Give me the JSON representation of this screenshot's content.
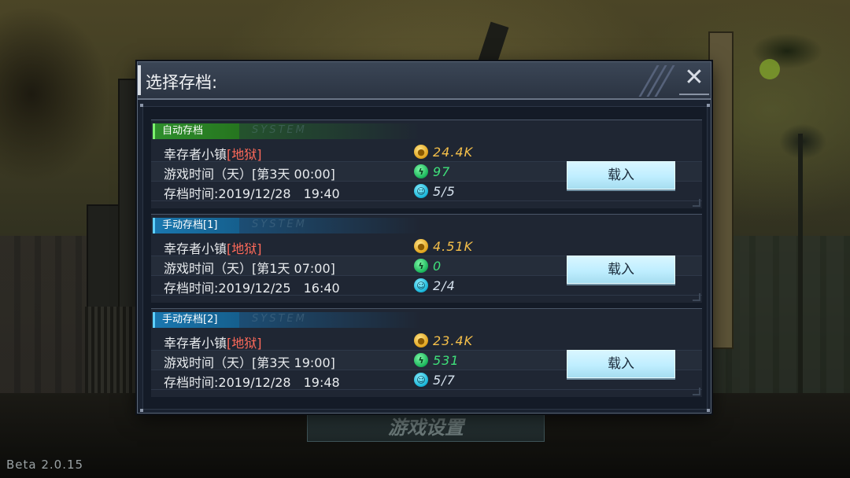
{
  "dialog": {
    "title": "选择存档:",
    "close_label": "✕"
  },
  "slots": [
    {
      "tag": "自动存档",
      "tag_color": "#3cc23a",
      "watermark": "SYSTEM",
      "town_name": "幸存者小镇",
      "difficulty": "[地狱]",
      "playtime": "游戏时间（天）[第3天 00:00]",
      "saved_at": "存档时间:2019/12/28　19:40",
      "coins": "24.4K",
      "energy": "97",
      "survivors": "5/5",
      "load_label": "载入"
    },
    {
      "tag": "手动存档[1]",
      "tag_color": "#1e9ad6",
      "watermark": "SYSTEM",
      "town_name": "幸存者小镇",
      "difficulty": "[地狱]",
      "playtime": "游戏时间（天）[第1天 07:00]",
      "saved_at": "存档时间:2019/12/25　16:40",
      "coins": "4.51K",
      "energy": "0",
      "survivors": "2/4",
      "load_label": "载入"
    },
    {
      "tag": "手动存档[2]",
      "tag_color": "#1e9ad6",
      "watermark": "SYSTEM",
      "town_name": "幸存者小镇",
      "difficulty": "[地狱]",
      "playtime": "游戏时间（天）[第3天 19:00]",
      "saved_at": "存档时间:2019/12/28　19:48",
      "coins": "23.4K",
      "energy": "531",
      "survivors": "5/7",
      "load_label": "载入"
    }
  ],
  "background": {
    "settings_label": "游戏设置",
    "version": "Beta 2.0.15"
  },
  "icons": {
    "coin": "coin-icon",
    "energy": "energy-icon",
    "survivors": "survivor-icon"
  }
}
